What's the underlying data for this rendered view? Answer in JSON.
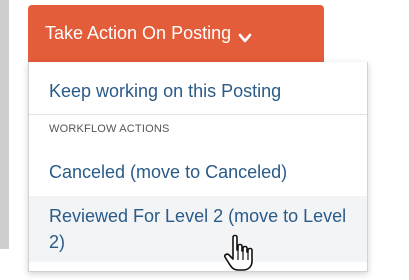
{
  "action_menu": {
    "button_label": "Take Action On Posting",
    "button_icon": "chevron-down-icon",
    "colors": {
      "button_bg": "#e35d3b",
      "link_text": "#2a5a88",
      "hover_bg": "#f2f4f6"
    },
    "items": {
      "keep_working": "Keep working on this Posting",
      "section_header": "WORKFLOW ACTIONS",
      "canceled": "Canceled (move to Canceled)",
      "reviewed": "Reviewed For Level 2 (move to Level 2)"
    },
    "cursor_icon": "hand-pointer-icon"
  }
}
